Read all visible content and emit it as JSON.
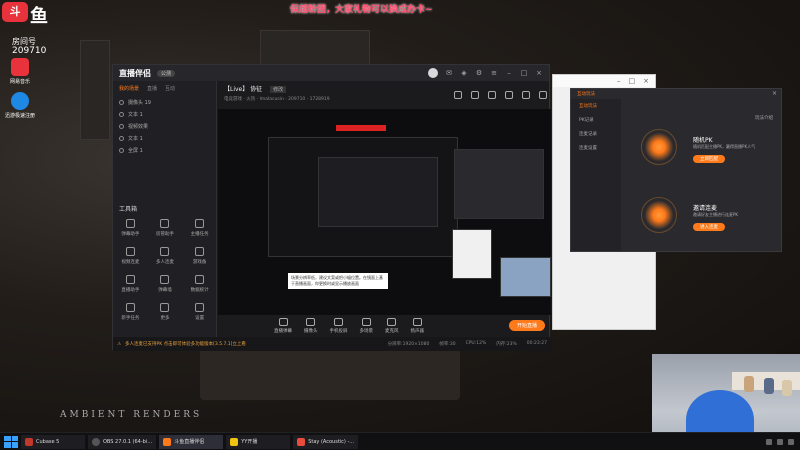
{
  "banner": "保超粉团，大家礼物可以换成办卡~",
  "overlay": {
    "logo_mark": "斗",
    "logo_text": "鱼",
    "room_label": "房间号",
    "room_number": "209710"
  },
  "desktop_icons": [
    {
      "label": "网易音乐"
    },
    {
      "label": "迅游极速注册"
    }
  ],
  "wallpaper": {
    "brand": "AMBIENT RENDERS"
  },
  "app": {
    "brand": "直播伴侣",
    "brand_badge": "公测",
    "left_tabs": [
      "我的场景",
      "直播",
      "互动"
    ],
    "scenes": [
      "摄像头 19",
      "文本 1",
      "视频效果",
      "文本 1",
      "全屏 1"
    ],
    "tools_header": "工具箱",
    "tools": [
      "弹幕助手",
      "房管助手",
      "主播任务",
      "视频连麦",
      "多人连麦",
      "游戏备",
      "直播助手",
      "弹幕墙",
      "数据统计",
      "新手任务",
      "更多",
      "设置"
    ],
    "stream_title": "【Live】 协征",
    "stream_tag": "修改",
    "stream_meta": "电竞游戏 · 火热 · Imalacusin · 209710 · 1728919",
    "tooltip": "场景分辨率低，建议文案或把小幅位置。在镜面上基于直播画面，你更换时或显示播放画面",
    "bottom": [
      "直播弹幕",
      "摄像头",
      "手机投屏",
      "多场景",
      "麦克风",
      "扬声器"
    ],
    "start_btn": "开始直播",
    "status_notice": "多人连麦已支持PK 点击即可体验多功能版本[3.5.7.1]立上看",
    "status_stats": [
      "分辨率:1920×1080",
      "帧率:30",
      "CPU:12%",
      "内存:23%",
      "00:23:27"
    ]
  },
  "pk": {
    "title": "互动玩法",
    "side": [
      "互动玩法",
      "PK记录",
      "连麦记录",
      "连麦设置"
    ],
    "intro": "玩法介绍",
    "cards": [
      {
        "title": "随机PK",
        "desc": "随机匹配主播PK，赢得直播PK人气",
        "btn": "立即匹配"
      },
      {
        "title": "邀请连麦",
        "desc": "邀请好友主播进行连麦PK",
        "btn": "进入连麦"
      }
    ]
  },
  "taskbar": [
    {
      "label": "Cubase 5",
      "color": "#c0392b"
    },
    {
      "label": "OBS 27.0.1 (64-bi…",
      "color": "#333333"
    },
    {
      "label": "斗鱼直播伴侣",
      "color": "#ff7a1a"
    },
    {
      "label": "YY开播",
      "color": "#f1c40f"
    },
    {
      "label": "Stay (Acoustic) -…",
      "color": "#e74c3c"
    }
  ]
}
